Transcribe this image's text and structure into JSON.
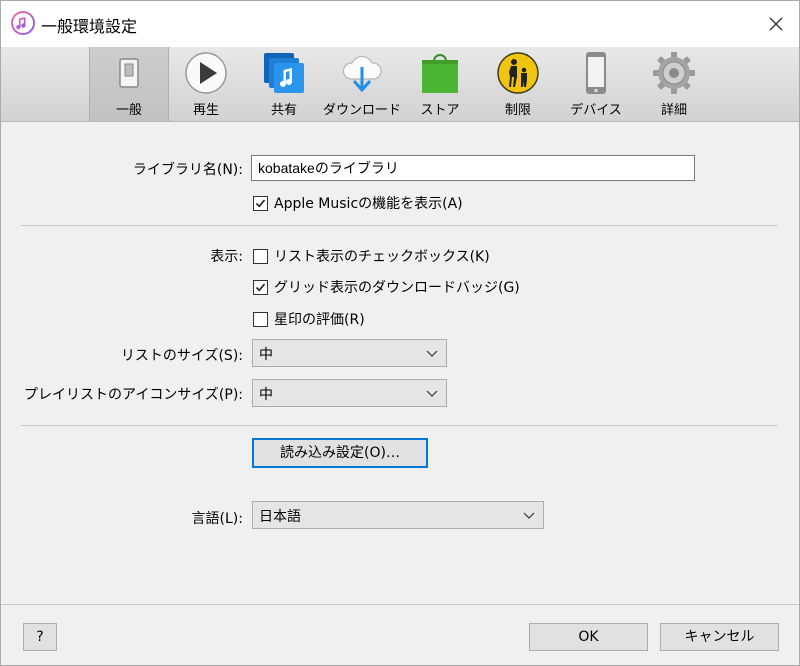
{
  "window": {
    "title": "一般環境設定"
  },
  "toolbar": {
    "items": [
      {
        "label": "一般",
        "icon": "general-switch-icon"
      },
      {
        "label": "再生",
        "icon": "play-icon"
      },
      {
        "label": "共有",
        "icon": "shared-music-icon"
      },
      {
        "label": "ダウンロード",
        "icon": "cloud-download-icon"
      },
      {
        "label": "ストア",
        "icon": "store-bag-icon"
      },
      {
        "label": "制限",
        "icon": "parental-restriction-icon"
      },
      {
        "label": "デバイス",
        "icon": "device-phone-icon"
      },
      {
        "label": "詳細",
        "icon": "gear-icon"
      }
    ],
    "active_index": 0
  },
  "library": {
    "label": "ライブラリ名(N):",
    "value": "kobatakeのライブラリ",
    "apple_music": {
      "label": "Apple Musicの機能を表示(A)",
      "checked": true
    }
  },
  "display": {
    "label": "表示:",
    "list_checkboxes": {
      "label": "リスト表示のチェックボックス(K)",
      "checked": false
    },
    "grid_badges": {
      "label": "グリッド表示のダウンロードバッジ(G)",
      "checked": true
    },
    "star_ratings": {
      "label": "星印の評価(R)",
      "checked": false
    }
  },
  "list_size": {
    "label": "リストのサイズ(S):",
    "value": "中"
  },
  "playlist_icon_size": {
    "label": "プレイリストのアイコンサイズ(P):",
    "value": "中"
  },
  "import_button": {
    "label": "読み込み設定(O)…"
  },
  "language": {
    "label": "言語(L):",
    "value": "日本語"
  },
  "footer": {
    "help": "?",
    "ok": "OK",
    "cancel": "キャンセル"
  }
}
